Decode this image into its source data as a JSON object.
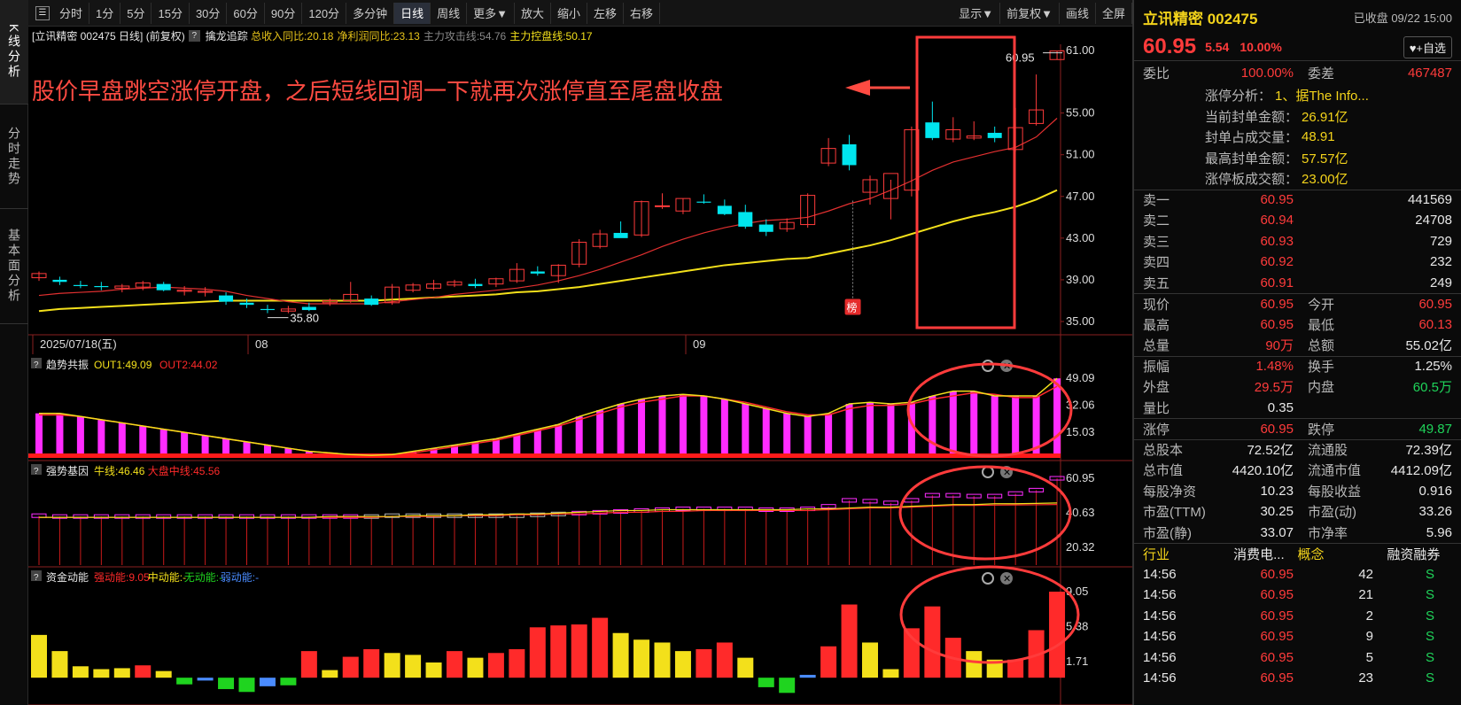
{
  "left_tabs": [
    "K线分析",
    "分时走势",
    "基本面分析"
  ],
  "toolbar": {
    "left": [
      "分时",
      "1分",
      "5分",
      "15分",
      "30分",
      "60分",
      "90分",
      "120分",
      "多分钟",
      "日线",
      "周线",
      "更多▼",
      "放大",
      "缩小",
      "左移",
      "右移"
    ],
    "active": "日线",
    "right": [
      "显示▼",
      "前复权▼",
      "画线",
      "全屏"
    ]
  },
  "chart_header": {
    "title": "[立讯精密 002475 日线]",
    "adjust": "(前复权)",
    "indicator": "擒龙追踪",
    "stats": [
      {
        "t": "总收入同比:20.18",
        "c": "#e6c31a"
      },
      {
        "t": "净利润同比:23.13",
        "c": "#e6c31a"
      },
      {
        "t": "主力攻击线:54.76",
        "c": "#888888"
      },
      {
        "t": "主力控盘线:50.17",
        "c": "#f3e01b"
      }
    ]
  },
  "annotation": "股价早盘跳空涨停开盘，之后短线回调一下就再次涨停直至尾盘收盘",
  "price_axis": [
    "61.00",
    "55.00",
    "51.00",
    "47.00",
    "43.00",
    "39.00",
    "35.00"
  ],
  "price_labels": {
    "high": "60.95",
    "low": "35.80",
    "board_badge": "榜"
  },
  "date_axis": [
    "2025/07/18(五)",
    "08",
    "09"
  ],
  "chart_data": [
    {
      "type": "candlestick",
      "title": "立讯精密 002475 日线",
      "ylim": [
        35,
        61
      ],
      "ohlc": [
        [
          39.2,
          39.8,
          38.9,
          39.6
        ],
        [
          39.0,
          39.3,
          38.5,
          38.8
        ],
        [
          38.5,
          38.9,
          38.2,
          38.4
        ],
        [
          38.4,
          38.8,
          38.0,
          38.3
        ],
        [
          38.2,
          38.6,
          37.8,
          38.4
        ],
        [
          38.3,
          38.9,
          38.0,
          38.7
        ],
        [
          38.6,
          38.8,
          37.9,
          38.0
        ],
        [
          37.9,
          38.4,
          37.5,
          38.0
        ],
        [
          37.8,
          38.3,
          37.4,
          37.9
        ],
        [
          37.5,
          37.8,
          36.6,
          36.9
        ],
        [
          36.8,
          37.2,
          36.3,
          36.6
        ],
        [
          36.2,
          36.6,
          35.8,
          36.1
        ],
        [
          36.0,
          36.5,
          35.8,
          36.2
        ],
        [
          36.4,
          36.8,
          36.0,
          36.1
        ],
        [
          36.8,
          37.2,
          36.5,
          37.0
        ],
        [
          37.0,
          38.8,
          36.8,
          37.6
        ],
        [
          37.2,
          37.5,
          36.5,
          36.6
        ],
        [
          36.8,
          38.6,
          36.6,
          38.3
        ],
        [
          38.0,
          38.7,
          37.8,
          38.5
        ],
        [
          38.2,
          39.0,
          38.0,
          38.6
        ],
        [
          38.5,
          39.0,
          38.3,
          38.8
        ],
        [
          38.6,
          39.1,
          38.2,
          38.4
        ],
        [
          38.6,
          39.2,
          38.3,
          39.1
        ],
        [
          38.9,
          40.6,
          38.7,
          40.0
        ],
        [
          39.8,
          40.3,
          39.4,
          39.6
        ],
        [
          39.4,
          40.5,
          38.7,
          40.4
        ],
        [
          40.5,
          42.9,
          40.2,
          42.6
        ],
        [
          42.2,
          43.8,
          42.0,
          43.4
        ],
        [
          43.5,
          44.6,
          43.2,
          43.0
        ],
        [
          43.3,
          46.6,
          43.1,
          46.5
        ],
        [
          46.1,
          47.3,
          45.8,
          46.1
        ],
        [
          45.6,
          46.8,
          45.3,
          46.8
        ],
        [
          46.5,
          47.2,
          46.3,
          46.4
        ],
        [
          46.1,
          46.7,
          45.2,
          45.3
        ],
        [
          45.5,
          46.2,
          43.9,
          44.1
        ],
        [
          44.3,
          44.8,
          43.2,
          43.6
        ],
        [
          43.9,
          44.9,
          43.6,
          44.5
        ],
        [
          44.3,
          47.3,
          44.0,
          47.1
        ],
        [
          50.2,
          52.6,
          49.9,
          51.6
        ],
        [
          52.0,
          52.9,
          49.5,
          50.0
        ],
        [
          47.4,
          49.0,
          46.2,
          48.6
        ],
        [
          46.8,
          48.6,
          44.8,
          49.2
        ],
        [
          47.6,
          53.7,
          47.0,
          53.4
        ],
        [
          54.1,
          56.1,
          52.4,
          52.6
        ],
        [
          52.5,
          54.6,
          52.2,
          53.4
        ],
        [
          52.6,
          54.2,
          52.4,
          52.8
        ],
        [
          53.1,
          53.7,
          52.2,
          52.6
        ],
        [
          51.5,
          55.5,
          51.3,
          53.6
        ],
        [
          54.0,
          58.7,
          53.8,
          55.3
        ],
        [
          60.13,
          60.95,
          60.13,
          60.95
        ]
      ],
      "ma_short": [
        37.5,
        37.7,
        37.8,
        37.9,
        38.1,
        38.2,
        38.3,
        38.2,
        38.1,
        37.9,
        37.5,
        37.2,
        36.9,
        36.7,
        36.7,
        36.7,
        36.7,
        36.9,
        37.1,
        37.3,
        37.6,
        37.8,
        38.0,
        38.2,
        38.5,
        38.9,
        39.4,
        40.0,
        40.7,
        41.4,
        42.2,
        42.9,
        43.5,
        44.0,
        44.4,
        44.7,
        44.8,
        45.0,
        45.6,
        46.3,
        46.8,
        47.6,
        48.5,
        49.5,
        50.3,
        50.8,
        51.3,
        51.7,
        52.7,
        54.5
      ],
      "ma_long": [
        36.0,
        36.2,
        36.3,
        36.4,
        36.5,
        36.6,
        36.7,
        36.8,
        36.9,
        37.0,
        37.0,
        37.0,
        37.0,
        37.0,
        37.0,
        37.0,
        37.0,
        37.1,
        37.2,
        37.3,
        37.4,
        37.5,
        37.6,
        37.8,
        37.9,
        38.1,
        38.3,
        38.6,
        38.9,
        39.2,
        39.5,
        39.8,
        40.1,
        40.4,
        40.6,
        40.8,
        41.0,
        41.1,
        41.5,
        41.9,
        42.3,
        42.8,
        43.4,
        44.0,
        44.6,
        45.1,
        45.5,
        46.0,
        46.7,
        47.6
      ]
    },
    {
      "type": "bar",
      "title": "趋势共振",
      "legend": [
        {
          "name": "OUT1:49.09",
          "color": "#f3e01b"
        },
        {
          "name": "OUT2:44.02",
          "color": "#ff2a2a"
        }
      ],
      "axis": [
        "49.09",
        "32.06",
        "15.03"
      ],
      "ylim": [
        0,
        52
      ],
      "values": [
        27,
        27,
        25,
        23,
        21,
        19,
        17,
        15,
        13,
        11,
        9,
        7,
        5,
        3,
        2,
        1,
        0.5,
        1,
        3,
        5,
        7,
        9,
        11,
        14,
        17,
        20,
        25,
        29,
        33,
        36,
        38,
        39,
        38,
        36,
        33,
        30,
        27,
        25,
        27,
        33,
        34,
        33,
        34,
        38,
        41,
        41,
        38,
        38,
        38,
        49.09
      ],
      "out1": [
        27,
        27,
        25,
        23,
        21,
        19,
        17,
        15,
        13,
        11,
        9,
        7,
        5,
        3,
        2,
        1,
        0.5,
        1,
        3,
        5,
        7,
        9,
        11,
        14,
        17,
        20,
        25,
        29,
        33,
        36,
        38,
        39,
        38,
        36,
        33,
        30,
        27,
        25,
        27,
        33,
        34,
        33,
        34,
        38,
        41,
        41,
        38,
        38,
        38,
        49.09
      ],
      "out2": [
        26,
        26,
        25,
        23,
        21,
        19,
        17,
        15,
        13,
        11,
        9,
        7,
        5,
        3,
        2,
        1,
        1,
        1,
        2,
        4,
        6,
        8,
        10,
        13,
        16,
        19,
        23,
        27,
        31,
        34,
        36,
        38,
        38,
        36,
        34,
        31,
        28,
        26,
        26,
        30,
        32,
        32,
        33,
        36,
        38,
        40,
        39,
        37,
        37,
        44.02
      ]
    },
    {
      "type": "bar",
      "title": "强势基因",
      "legend": [
        {
          "name": "牛线:46.46",
          "color": "#f3e01b"
        },
        {
          "name": "大盘中线:45.56",
          "color": "#ff2a2a"
        }
      ],
      "axis": [
        "60.95",
        "40.63",
        "20.32"
      ],
      "ylim": [
        10,
        62
      ],
      "values": [
        39,
        38.5,
        38.5,
        38.5,
        38.5,
        38.5,
        38.5,
        38.5,
        38.5,
        38.5,
        38.5,
        38.5,
        38.5,
        38.5,
        38.5,
        38.5,
        38.5,
        39,
        39,
        39,
        39,
        39,
        39,
        39,
        39.5,
        40,
        40.5,
        41,
        41.5,
        42,
        42.5,
        43,
        43,
        43,
        43,
        42.5,
        42.5,
        43,
        44.5,
        48,
        47.5,
        46.5,
        48,
        51,
        51,
        50.5,
        50.5,
        52,
        54,
        60.95
      ],
      "bull_line": [
        38,
        38,
        38,
        38,
        38,
        38,
        38,
        38,
        38,
        38,
        38,
        38,
        38,
        38,
        38.5,
        38.5,
        38.5,
        38.5,
        39,
        39,
        39,
        39.5,
        39.5,
        40,
        40,
        40.5,
        41,
        41.5,
        42,
        42,
        42.5,
        42.5,
        42.5,
        42.5,
        42.5,
        42.5,
        42.5,
        43,
        43,
        43.5,
        44,
        44,
        44.5,
        45,
        45.5,
        45.5,
        46,
        46,
        46.2,
        46.46
      ],
      "mid_line": [
        38,
        38,
        38,
        38,
        38,
        38,
        38,
        38,
        38,
        38,
        38,
        38,
        38,
        38,
        38,
        38,
        38,
        38.5,
        38.5,
        38.5,
        39,
        39,
        39,
        39.5,
        39.5,
        40,
        40,
        40.5,
        41,
        41,
        41.5,
        41.5,
        42,
        42,
        42,
        42,
        42,
        42,
        42.5,
        43,
        43.5,
        43.5,
        44,
        44.5,
        45,
        45,
        45.2,
        45.3,
        45.4,
        45.56
      ]
    },
    {
      "type": "bar",
      "title": "资金动能",
      "legend": [
        {
          "name": "强动能:9.05",
          "color": "#ff2a2a"
        },
        {
          "name": "中动能:-",
          "color": "#f3e01b"
        },
        {
          "name": "无动能:-",
          "color": "#1fd41f"
        },
        {
          "name": "弱动能:-",
          "color": "#4a8cff"
        }
      ],
      "axis": [
        "9.05",
        "5.38",
        "1.71"
      ],
      "ylim": [
        -2.5,
        9.8
      ],
      "values": [
        4.5,
        2.8,
        1.2,
        0.9,
        1.0,
        1.3,
        0.7,
        -0.7,
        -0.3,
        -1.2,
        -1.5,
        -0.9,
        -0.8,
        2.8,
        0.8,
        2.2,
        3.0,
        2.6,
        2.4,
        1.6,
        2.8,
        2.1,
        2.6,
        3.0,
        5.3,
        5.5,
        5.6,
        6.3,
        4.7,
        4.0,
        3.7,
        2.8,
        3.0,
        3.7,
        2.1,
        -1.0,
        -1.6,
        0.3,
        3.3,
        7.7,
        3.7,
        0.9,
        5.2,
        7.5,
        4.2,
        2.8,
        1.9,
        1.9,
        5.0,
        9.05
      ],
      "colors": [
        "#f3e01b",
        "#f3e01b",
        "#f3e01b",
        "#f3e01b",
        "#f3e01b",
        "#ff2a2a",
        "#f3e01b",
        "#1fd41f",
        "#4a8cff",
        "#1fd41f",
        "#1fd41f",
        "#4a8cff",
        "#1fd41f",
        "#ff2a2a",
        "#f3e01b",
        "#ff2a2a",
        "#ff2a2a",
        "#f3e01b",
        "#f3e01b",
        "#f3e01b",
        "#ff2a2a",
        "#f3e01b",
        "#ff2a2a",
        "#ff2a2a",
        "#ff2a2a",
        "#ff2a2a",
        "#ff2a2a",
        "#ff2a2a",
        "#f3e01b",
        "#f3e01b",
        "#f3e01b",
        "#f3e01b",
        "#ff2a2a",
        "#ff2a2a",
        "#f3e01b",
        "#1fd41f",
        "#1fd41f",
        "#4a8cff",
        "#ff2a2a",
        "#ff2a2a",
        "#f3e01b",
        "#f3e01b",
        "#ff2a2a",
        "#ff2a2a",
        "#ff2a2a",
        "#f3e01b",
        "#f3e01b",
        "#ff2a2a",
        "#ff2a2a",
        "#ff2a2a"
      ]
    }
  ],
  "quote": {
    "name": "立讯精密 002475",
    "status": "已收盘 09/22 15:00",
    "price": "60.95",
    "change": "5.54",
    "pct": "10.00%",
    "watch": "♥+自选",
    "wb_label": "委比",
    "wb": "100.00%",
    "wc_label": "委差",
    "wc": "467487",
    "limit_info": [
      [
        "涨停分析：",
        "1、据The Info..."
      ],
      [
        "当前封单金额：",
        "26.91亿"
      ],
      [
        "封单占成交量：",
        "48.91"
      ],
      [
        "最高封单金额：",
        "57.57亿"
      ],
      [
        "涨停板成交额：",
        "23.00亿"
      ]
    ],
    "sell": [
      [
        "卖一",
        "60.95",
        "441569"
      ],
      [
        "卖二",
        "60.94",
        "24708"
      ],
      [
        "卖三",
        "60.93",
        "729"
      ],
      [
        "卖四",
        "60.92",
        "232"
      ],
      [
        "卖五",
        "60.91",
        "249"
      ]
    ],
    "stats1": [
      [
        "现价",
        "60.95",
        "今开",
        "60.95"
      ],
      [
        "最高",
        "60.95",
        "最低",
        "60.13"
      ],
      [
        "总量",
        "90万",
        "总额",
        "55.02亿"
      ]
    ],
    "stats2": [
      [
        "振幅",
        "1.48%",
        "换手",
        "1.25%"
      ],
      [
        "外盘",
        "29.5万",
        "内盘",
        "60.5万"
      ],
      [
        "量比",
        "0.35",
        "",
        ""
      ]
    ],
    "limits": [
      [
        "涨停",
        "60.95",
        "跌停",
        "49.87"
      ]
    ],
    "fund": [
      [
        "总股本",
        "72.52亿",
        "流通股",
        "72.39亿"
      ],
      [
        "总市值",
        "4420.10亿",
        "流通市值",
        "4412.09亿"
      ],
      [
        "每股净资",
        "10.23",
        "每股收益",
        "0.916"
      ],
      [
        "市盈(TTM)",
        "30.25",
        "市盈(动)",
        "33.26"
      ],
      [
        "市盈(静)",
        "33.07",
        "市净率",
        "5.96"
      ]
    ],
    "tabs": [
      "行业",
      "消费电...",
      "概念",
      "融资融券"
    ],
    "ticks": [
      [
        "14:56",
        "60.95",
        "42",
        "S"
      ],
      [
        "14:56",
        "60.95",
        "21",
        "S"
      ],
      [
        "14:56",
        "60.95",
        "2",
        "S"
      ],
      [
        "14:56",
        "60.95",
        "9",
        "S"
      ],
      [
        "14:56",
        "60.95",
        "5",
        "S"
      ],
      [
        "14:56",
        "60.95",
        "23",
        "S"
      ]
    ]
  }
}
